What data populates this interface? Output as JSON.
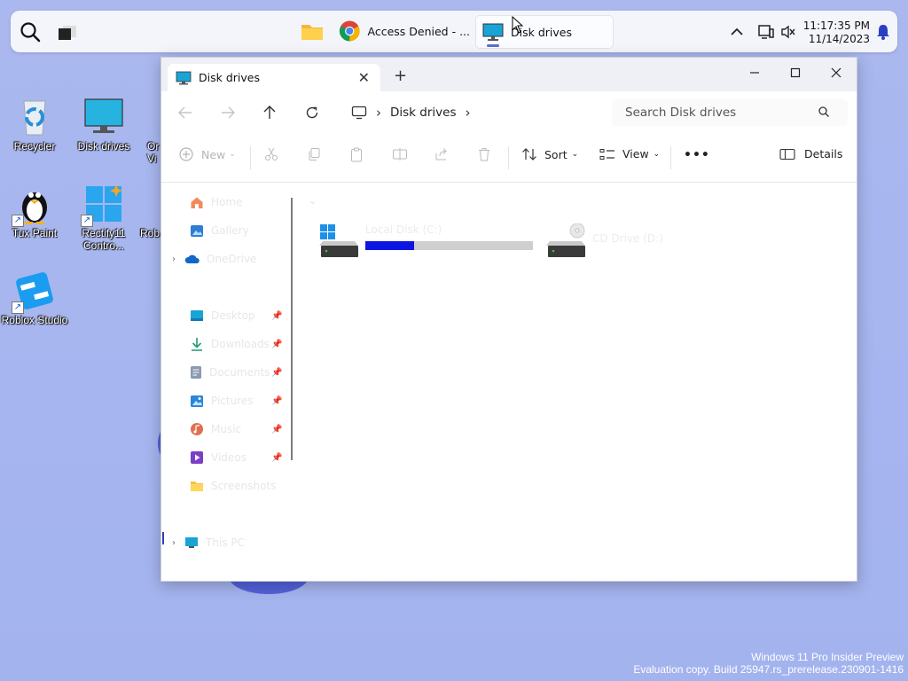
{
  "taskbar": {
    "apps": [
      {
        "name": "File Explorer",
        "label": ""
      },
      {
        "name": "Google Chrome",
        "label": "Access Denied - ..."
      },
      {
        "name": "Disk drives",
        "label": "Disk drives"
      }
    ],
    "clock": {
      "time": "11:17:35 PM",
      "date": "11/14/2023"
    }
  },
  "desktop": {
    "icons": [
      {
        "label": "Recycler"
      },
      {
        "label": "Disk drives"
      },
      {
        "label": "Or Vi"
      },
      {
        "label": "Tux Paint"
      },
      {
        "label": "Rectify11 Contro..."
      },
      {
        "label": "Rob"
      },
      {
        "label": "Roblox Studio"
      }
    ],
    "watermark": {
      "line1": "Windows 11 Pro Insider Preview",
      "line2": "Evaluation copy. Build 25947.rs_prerelease.230901-1416"
    }
  },
  "window": {
    "tab_title": "Disk drives",
    "breadcrumb": "Disk drives",
    "search_placeholder": "Search Disk drives",
    "commands": {
      "new": "New",
      "sort": "Sort",
      "view": "View",
      "more": "•••",
      "details": "Details"
    },
    "nav_items": [
      {
        "label": "Home"
      },
      {
        "label": "Gallery"
      },
      {
        "label": "OneDrive"
      },
      {
        "label": "Desktop"
      },
      {
        "label": "Downloads"
      },
      {
        "label": "Documents"
      },
      {
        "label": "Pictures"
      },
      {
        "label": "Music"
      },
      {
        "label": "Videos"
      },
      {
        "label": "Screenshots"
      },
      {
        "label": "This PC"
      }
    ],
    "drives": [
      {
        "label": "Local Disk (C:)",
        "usage_fraction": 0.29
      },
      {
        "label": "CD Drive (D:)"
      }
    ],
    "colors": {
      "usage_bar": "#0d16e0",
      "accent": "#5a6ec9"
    }
  }
}
